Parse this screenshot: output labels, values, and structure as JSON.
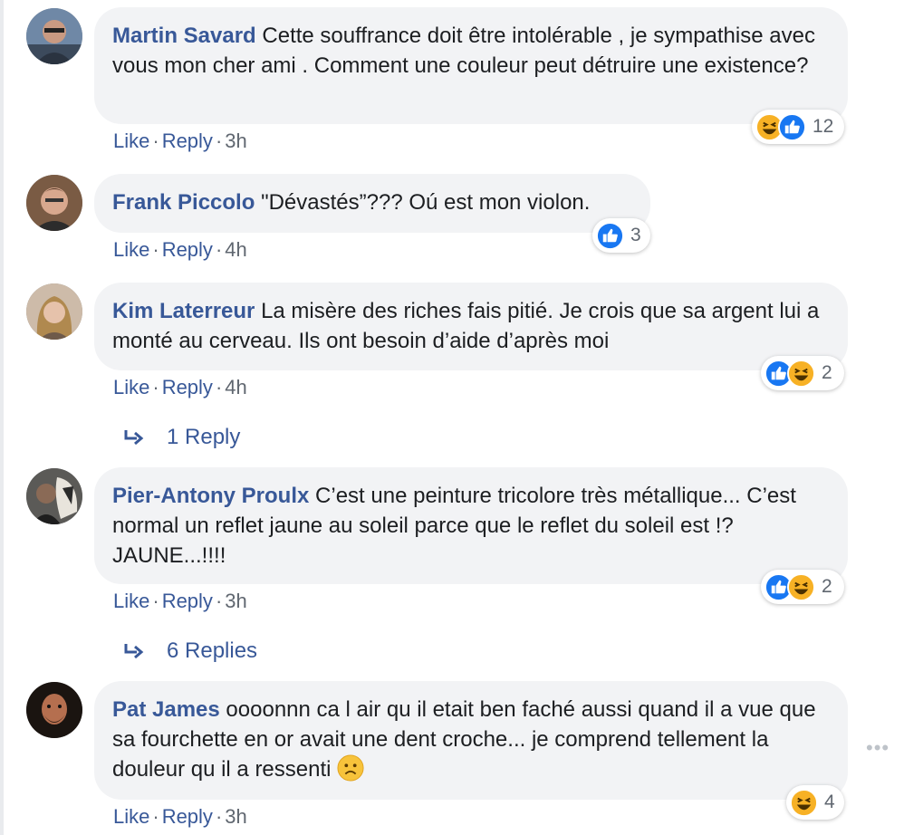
{
  "comments": [
    {
      "author": "Martin Savard",
      "text": "Cette souffrance doit être intolérable , je sympathise avec vous mon cher ami . Comment une couleur peut détruire une existence?",
      "like": "Like",
      "reply": "Reply",
      "time": "3h",
      "reactions": [
        "haha-icon",
        "like-icon"
      ],
      "reaction_count": "12"
    },
    {
      "author": "Frank Piccolo",
      "text": "\"Dévastés”??? Oú est mon violon.",
      "like": "Like",
      "reply": "Reply",
      "time": "4h",
      "reactions": [
        "like-icon"
      ],
      "reaction_count": "3"
    },
    {
      "author": "Kim Laterreur",
      "text": "La misère des riches fais pitié. Je crois que sa argent lui a monté au cerveau. Ils ont besoin d’aide d’après moi",
      "like": "Like",
      "reply": "Reply",
      "time": "4h",
      "reactions": [
        "like-icon",
        "haha-icon"
      ],
      "reaction_count": "2",
      "replies_label": "1 Reply"
    },
    {
      "author": "Pier-Antony Proulx",
      "text": "C’est une peinture tricolore très métallique... C’est normal un reflet jaune au soleil parce que le reflet du soleil est !? JAUNE...!!!!",
      "like": "Like",
      "reply": "Reply",
      "time": "3h",
      "reactions": [
        "like-icon",
        "haha-icon"
      ],
      "reaction_count": "2",
      "replies_label": "6 Replies"
    },
    {
      "author": "Pat James",
      "text": "oooonnn ca l air qu il etait ben faché aussi quand il a vue que sa fourchette en or avait une dent croche... je comprend tellement la douleur qu il a ressenti",
      "inline_emoji": "frowning-face-emoji",
      "like": "Like",
      "reply": "Reply",
      "time": "3h",
      "reactions": [
        "haha-icon"
      ],
      "reaction_count": "4"
    }
  ],
  "more_options": "•••",
  "colors": {
    "link": "#385898",
    "bubble": "#f2f3f5",
    "meta": "#606770",
    "like_blue": "#1877f2",
    "haha_yellow": "#f7b125"
  }
}
